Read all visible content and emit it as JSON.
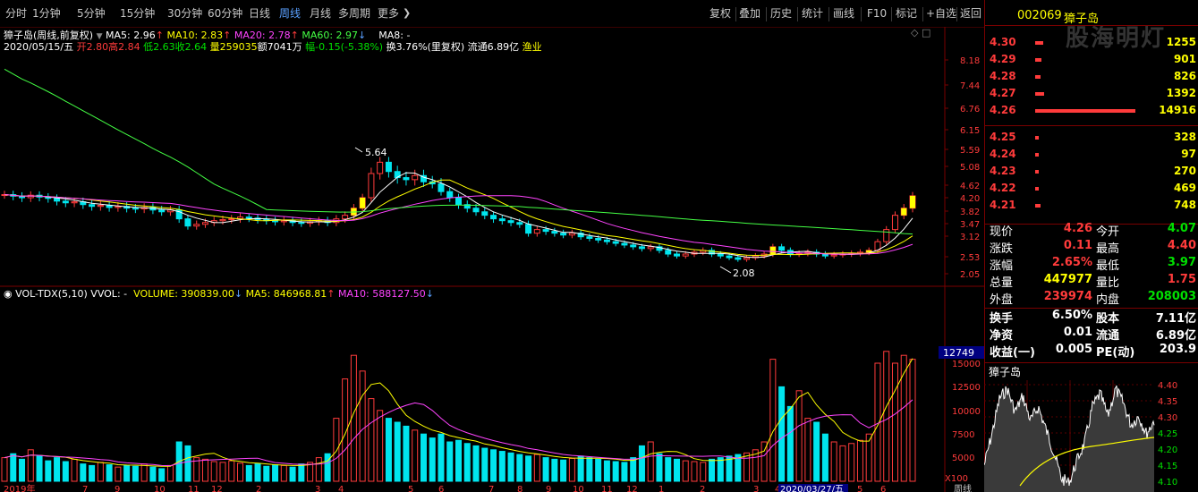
{
  "toolbar": {
    "tabs": [
      "分时",
      "1分钟",
      "5分钟",
      "15分钟",
      "30分钟",
      "60分钟",
      "日线",
      "周线",
      "月线",
      "多周期",
      "更多"
    ],
    "active": "周线",
    "actions": [
      "复权",
      "叠加",
      "历史",
      "统计",
      "画线",
      "F10",
      "标记",
      "+自选",
      "返回"
    ]
  },
  "header": {
    "name": "獐子岛",
    "mode": "(周线,前复权)",
    "ma5": "MA5: 2.96",
    "ma10": "MA10: 2.83",
    "ma20": "MA20: 2.78",
    "ma60": "MA60: 2.97",
    "ma8": "MA8: -",
    "date": "2020/05/15/五",
    "open": "开2.80",
    "high": "高2.84",
    "low": "低2.63",
    "close": "收2.64",
    "vol": "量259035",
    "amount": "额7041万",
    "change": "幅-0.15(-5.38%)",
    "turnover": "换3.76%(里复权)",
    "float_cap": "流通6.89亿",
    "industry": "渔业"
  },
  "price_axis": [
    "8.18",
    "7.44",
    "6.76",
    "6.15",
    "5.59",
    "5.08",
    "4.62",
    "4.20",
    "3.82",
    "3.47",
    "3.12",
    "2.53",
    "2.05"
  ],
  "annotations": {
    "high": "5.64",
    "low": "2.08"
  },
  "vol_header": {
    "title": "VOL-TDX(5,10)",
    "vvol": "VVOL: -",
    "volume": "VOLUME: 390839.00",
    "ma5": "MA5: 846968.81",
    "ma10": "MA10: 588127.50"
  },
  "vol_axis": [
    "15000",
    "12500",
    "10000",
    "7500",
    "5000"
  ],
  "vol_current": "12749",
  "vol_unit": "X100",
  "date_axis": [
    "2019年",
    "7",
    "9",
    "10",
    "11",
    "12",
    "2",
    "3",
    "4",
    "5",
    "6",
    "7",
    "8",
    "9",
    "10",
    "11",
    "12",
    "1",
    "2",
    "3",
    "4",
    "5",
    "6"
  ],
  "date_cursor": "2020/03/27/五",
  "period_label": "周线",
  "chart_data": {
    "type": "candlestick",
    "closes": [
      4.3,
      4.25,
      4.2,
      4.28,
      4.22,
      4.18,
      4.1,
      4.05,
      4.08,
      4.0,
      3.95,
      3.98,
      3.92,
      3.95,
      3.9,
      3.88,
      3.92,
      3.85,
      3.8,
      3.85,
      3.6,
      3.4,
      3.45,
      3.5,
      3.55,
      3.58,
      3.6,
      3.65,
      3.62,
      3.58,
      3.55,
      3.52,
      3.55,
      3.5,
      3.48,
      3.52,
      3.55,
      3.5,
      3.6,
      3.7,
      3.9,
      4.2,
      4.9,
      5.2,
      4.95,
      4.8,
      4.75,
      4.85,
      4.7,
      4.65,
      4.4,
      4.2,
      4.0,
      3.9,
      3.8,
      3.7,
      3.6,
      3.55,
      3.5,
      3.45,
      3.2,
      3.3,
      3.25,
      3.2,
      3.15,
      3.2,
      3.1,
      3.05,
      3.0,
      2.95,
      2.9,
      2.85,
      2.8,
      2.75,
      2.8,
      2.7,
      2.6,
      2.55,
      2.6,
      2.65,
      2.7,
      2.6,
      2.55,
      2.5,
      2.45,
      2.5,
      2.55,
      2.6,
      2.8,
      2.7,
      2.6,
      2.62,
      2.65,
      2.6,
      2.55,
      2.58,
      2.6,
      2.62,
      2.65,
      2.7,
      2.95,
      3.3,
      3.7,
      3.9,
      4.26
    ],
    "volumes": [
      3000,
      3500,
      2800,
      4000,
      3200,
      2600,
      3000,
      2500,
      2800,
      2200,
      2000,
      2400,
      2100,
      1800,
      2000,
      1900,
      2200,
      1800,
      1600,
      2000,
      5000,
      4500,
      3000,
      2800,
      2500,
      2400,
      2600,
      2300,
      2000,
      2200,
      1900,
      2100,
      2000,
      1800,
      2200,
      2400,
      3000,
      3500,
      8000,
      13000,
      16000,
      14000,
      10500,
      9000,
      8000,
      7500,
      7000,
      6500,
      6000,
      5500,
      6000,
      5000,
      5200,
      4800,
      4500,
      4200,
      4000,
      3800,
      3600,
      3400,
      3200,
      3400,
      3000,
      2800,
      2700,
      2900,
      3200,
      3000,
      2800,
      2600,
      2500,
      2400,
      3000,
      4500,
      5000,
      3500,
      3000,
      2800,
      2600,
      2500,
      2400,
      2800,
      3000,
      3200,
      3400,
      3600,
      4000,
      5000,
      15500,
      12000,
      9500,
      11500,
      8000,
      7500,
      6000,
      5000,
      4500,
      4800,
      5200,
      6000,
      15000,
      16500,
      15000,
      16000,
      15500
    ],
    "y_axis_ticks": [
      "8.18",
      "7.44",
      "6.76",
      "6.15",
      "5.59",
      "5.08",
      "4.62",
      "4.20",
      "3.82",
      "3.47",
      "3.12",
      "2.53",
      "2.05"
    ]
  },
  "quote": {
    "code": "002069",
    "name": "獐子岛",
    "watermark": "股海明灯",
    "asks": [
      {
        "price": "4.30",
        "vol": "1255",
        "bar": 0.08
      },
      {
        "price": "4.29",
        "vol": "901",
        "bar": 0.06
      },
      {
        "price": "4.28",
        "vol": "826",
        "bar": 0.055
      },
      {
        "price": "4.27",
        "vol": "1392",
        "bar": 0.09
      },
      {
        "price": "4.26",
        "vol": "14916",
        "bar": 1.0
      }
    ],
    "bids": [
      {
        "price": "4.25",
        "vol": "328",
        "bar": 0.03
      },
      {
        "price": "4.24",
        "vol": "97",
        "bar": 0.02
      },
      {
        "price": "4.23",
        "vol": "270",
        "bar": 0.025
      },
      {
        "price": "4.22",
        "vol": "469",
        "bar": 0.035
      },
      {
        "price": "4.21",
        "vol": "748",
        "bar": 0.05
      }
    ],
    "stats": [
      {
        "l1": "现价",
        "v1": "4.26",
        "c1": "#ff3b3b",
        "l2": "今开",
        "v2": "4.07",
        "c2": "#00e000"
      },
      {
        "l1": "涨跌",
        "v1": "0.11",
        "c1": "#ff3b3b",
        "l2": "最高",
        "v2": "4.40",
        "c2": "#ff3b3b"
      },
      {
        "l1": "涨幅",
        "v1": "2.65%",
        "c1": "#ff3b3b",
        "l2": "最低",
        "v2": "3.97",
        "c2": "#00e000"
      },
      {
        "l1": "总量",
        "v1": "447977",
        "c1": "#ffff00",
        "l2": "量比",
        "v2": "1.75",
        "c2": "#ff3b3b"
      },
      {
        "l1": "外盘",
        "v1": "239974",
        "c1": "#ff3b3b",
        "l2": "内盘",
        "v2": "208003",
        "c2": "#00e000"
      }
    ],
    "stats2": [
      {
        "l1": "换手",
        "v1": "6.50%",
        "l2": "股本",
        "v2": "7.11亿"
      },
      {
        "l1": "净资",
        "v1": "0.01",
        "l2": "流通",
        "v2": "6.89亿"
      },
      {
        "l1": "收益(一)",
        "v1": "0.005",
        "l2": "PE(动)",
        "v2": "203.9"
      }
    ],
    "mini_name": "獐子岛",
    "mini_axis": [
      "4.40",
      "4.35",
      "4.30",
      "4.25",
      "4.20",
      "4.15",
      "4.10"
    ]
  }
}
